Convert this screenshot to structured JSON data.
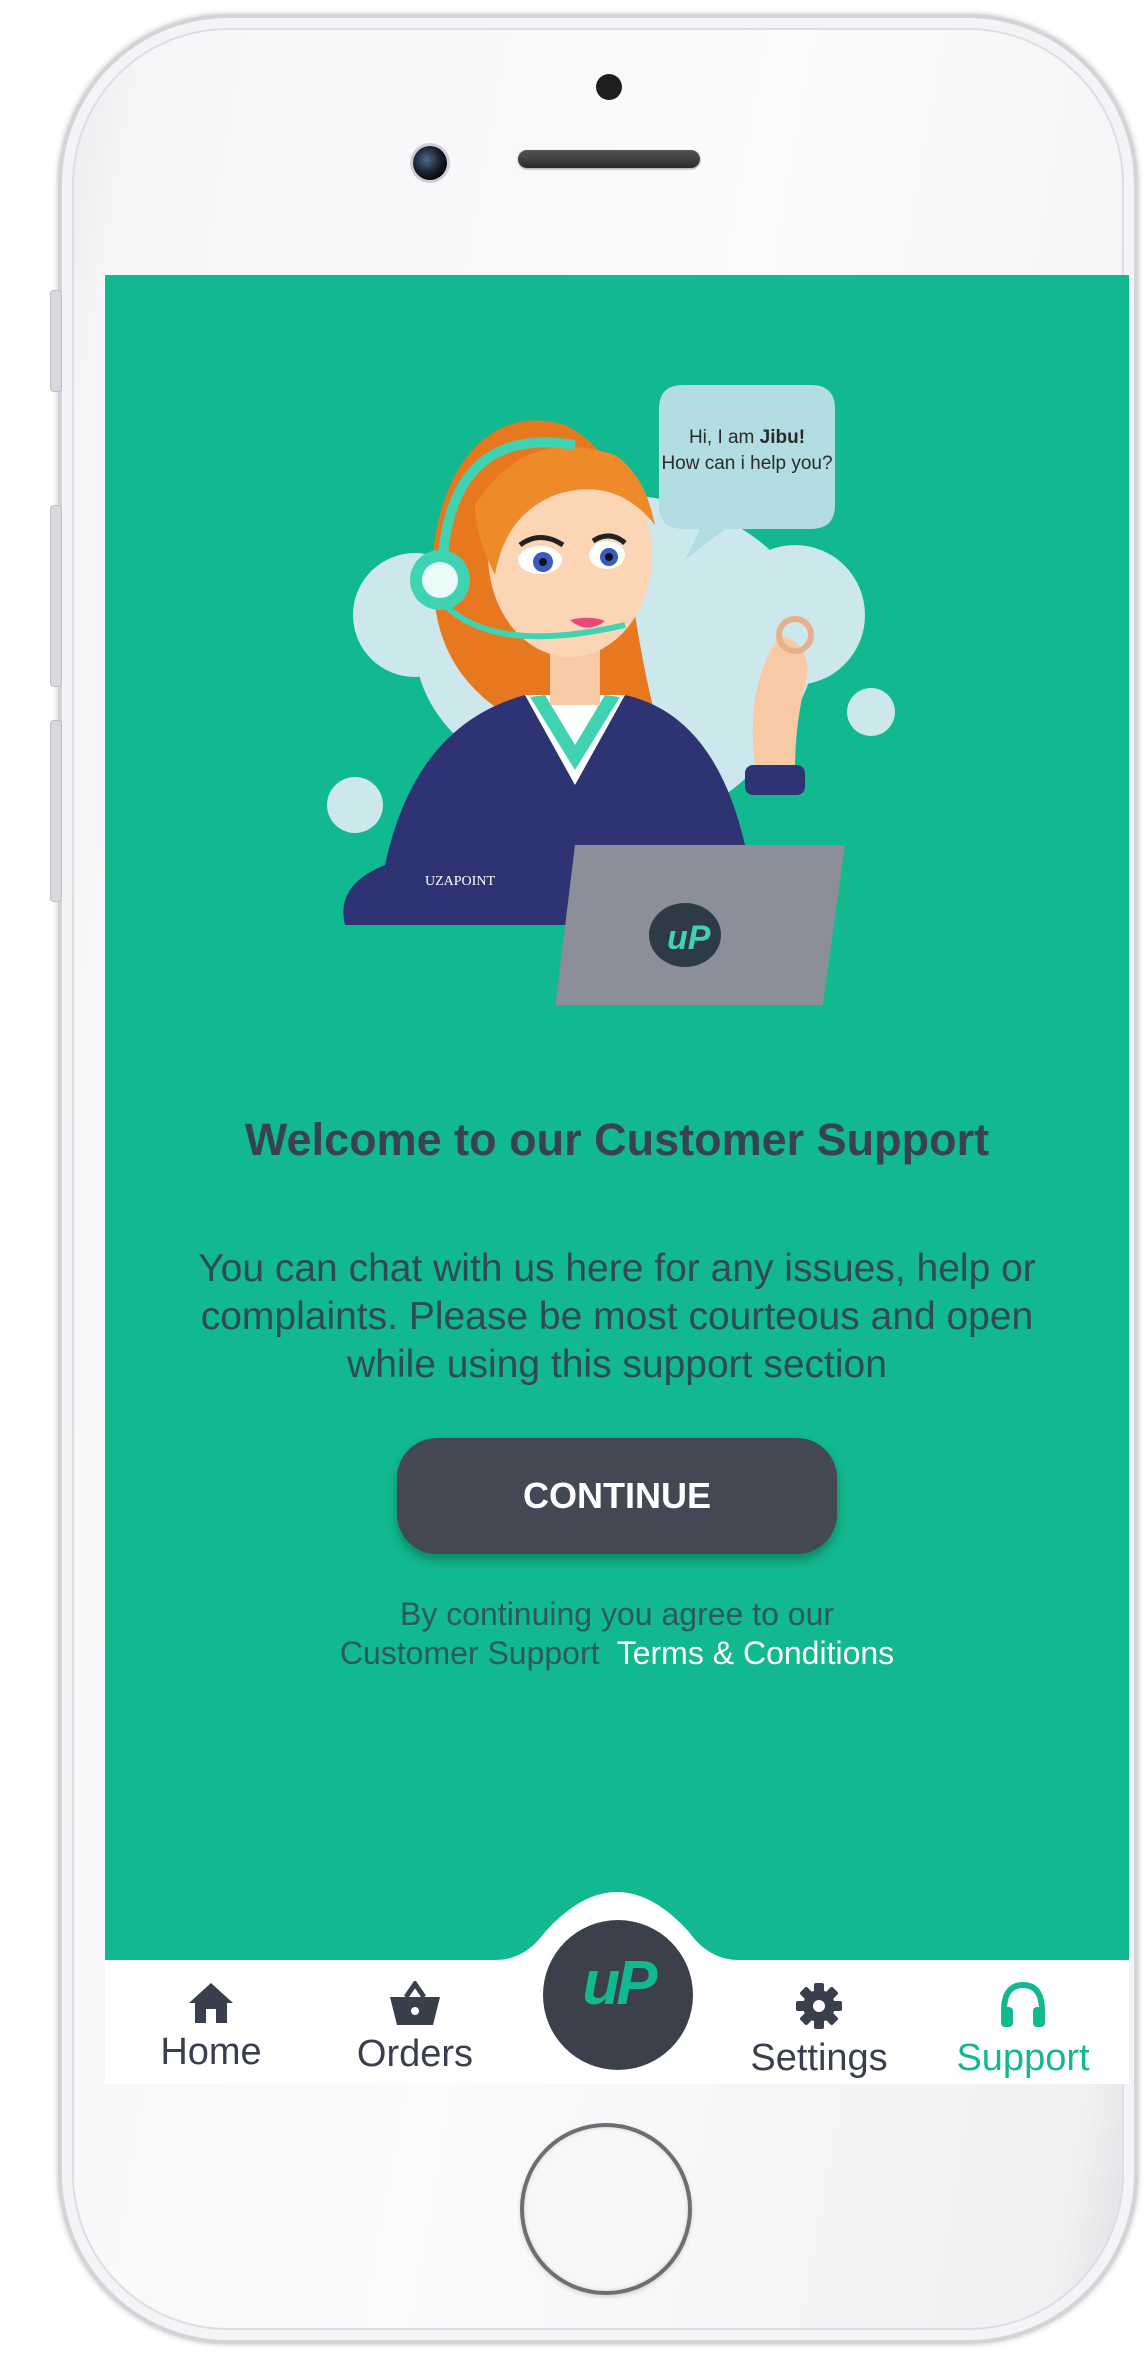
{
  "colors": {
    "primary": "#12b88f",
    "dark": "#3c3f4c",
    "title": "#3a4150",
    "text": "#2f4a52",
    "nav_bg": "#ffffff"
  },
  "illustration": {
    "speech_bubble": {
      "line1_prefix": "Hi, I am ",
      "line1_name": "Jibu!",
      "line2": "How can i help you?"
    },
    "shirt_brand": "UZAPOINT",
    "laptop_logo": "uP"
  },
  "main": {
    "title": "Welcome to our Customer Support",
    "description": "You can chat with us here for any issues, help or complaints. Please be most courteous and open while using this support section",
    "continue_label": "CONTINUE",
    "disclaimer_line1": "By continuing you agree to our",
    "disclaimer_line2_prefix": "Customer Support",
    "terms_link": "Terms & Conditions"
  },
  "nav": {
    "items": [
      {
        "label": "Home",
        "icon": "home-icon",
        "active": false
      },
      {
        "label": "Orders",
        "icon": "basket-icon",
        "active": false
      },
      {
        "label": "Settings",
        "icon": "gear-icon",
        "active": false
      },
      {
        "label": "Support",
        "icon": "headset-icon",
        "active": true
      }
    ],
    "center_logo": "uP"
  }
}
